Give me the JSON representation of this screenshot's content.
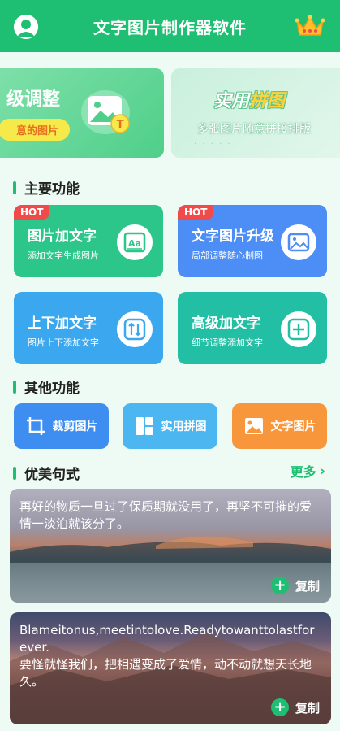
{
  "header": {
    "title": "文字图片制作器软件"
  },
  "banners": [
    {
      "title": "级调整",
      "subtitle": "意的图片",
      "badge": "T"
    },
    {
      "title_part1": "实用",
      "title_part2": "拼图",
      "subtitle": "多张图片随意拼接排版"
    }
  ],
  "sections": {
    "main": "主要功能",
    "other": "其他功能",
    "quotes": "优美句式",
    "more": "更多"
  },
  "features": [
    {
      "title": "图片加文字",
      "subtitle": "添加文字生成图片",
      "badge": "HOT",
      "icon_text": "Aa",
      "color": "#2cc58a"
    },
    {
      "title": "文字图片升级",
      "subtitle": "局部调整随心制图",
      "badge": "HOT",
      "color": "#4c8ef5"
    },
    {
      "title": "上下加文字",
      "subtitle": "图片上下添加文字",
      "color": "#3aa7ef"
    },
    {
      "title": "高级加文字",
      "subtitle": "细节调整添加文字",
      "color": "#22bfa4"
    }
  ],
  "other_functions": [
    {
      "label": "裁剪图片",
      "color": "#3d8ef0"
    },
    {
      "label": "实用拼图",
      "color": "#4bb6ef"
    },
    {
      "label": "文字图片",
      "color": "#f7963a"
    }
  ],
  "quotes": [
    {
      "text": "再好的物质一旦过了保质期就没用了，再坚不可摧的爱情一淡泊就该分了。",
      "copy_label": "复制"
    },
    {
      "text": "Blameitonus,meetintolove.Readytowanttolastforever.\n要怪就怪我们，把相遇变成了爱情，动不动就想天长地久。",
      "copy_label": "复制"
    }
  ]
}
